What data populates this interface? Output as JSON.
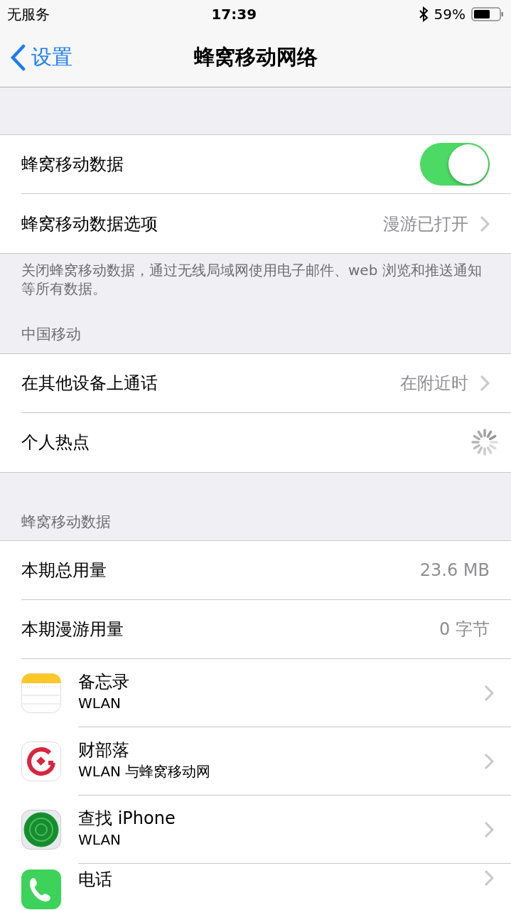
{
  "status_bar": {
    "carrier": "无服务",
    "time": "17:39",
    "battery": "59%"
  },
  "nav": {
    "back": "设置",
    "title": "蜂窝移动网络"
  },
  "sections": [
    {
      "rows": [
        {
          "kind": "toggle",
          "label": "蜂窝移动数据",
          "on": true
        },
        {
          "kind": "detail",
          "label": "蜂窝移动数据选项",
          "value": "漫游已打开"
        }
      ],
      "footer": "关闭蜂窝移动数据，通过无线局域网使用电子邮件、web 浏览和推送通知等所有数据。"
    },
    {
      "header": "中国移动",
      "rows": [
        {
          "kind": "detail",
          "label": "在其他设备上通话",
          "value": "在附近时"
        },
        {
          "kind": "spinner",
          "label": "个人热点"
        }
      ]
    },
    {
      "header": "蜂窝移动数据",
      "rows": [
        {
          "kind": "value",
          "label": "本期总用量",
          "value": "23.6 MB"
        },
        {
          "kind": "value",
          "label": "本期漫游用量",
          "value": "0 字节"
        },
        {
          "kind": "app",
          "label": "备忘录",
          "sub": "WLAN"
        },
        {
          "kind": "app",
          "label": "财部落",
          "sub": "WLAN 与蜂窝移动网"
        },
        {
          "kind": "app",
          "label": "查找 iPhone",
          "sub": "WLAN"
        },
        {
          "kind": "app",
          "label": "电话"
        }
      ]
    }
  ]
}
